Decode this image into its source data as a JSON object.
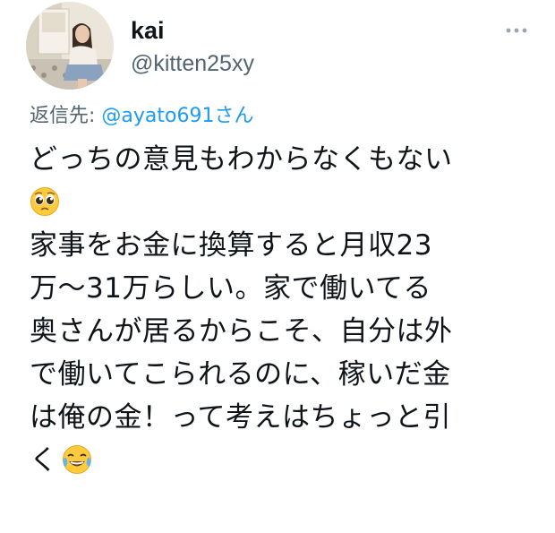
{
  "tweet": {
    "display_name": "kai",
    "handle": "@kitten25xy",
    "reply_prefix": "返信先: ",
    "reply_mention": "@ayato691さん",
    "body_lines": [
      "どっちの意見もわからなくもない",
      "",
      "家事をお金に換算すると月収23",
      "万〜31万らしい。家で働いてる",
      "奥さんが居るからこそ、自分は外",
      "で働いてこられるのに、稼いだ金",
      "は俺の金！って考えはちょっと引",
      "く"
    ]
  },
  "icons": {
    "avatar": "avatar-photo",
    "more": "more-options-icon",
    "emoji_1": "pleading-face-emoji",
    "emoji_2": "tears-of-joy-emoji"
  },
  "colors": {
    "text": "#0f1419",
    "secondary": "#536471",
    "link": "#1d9bf0"
  }
}
